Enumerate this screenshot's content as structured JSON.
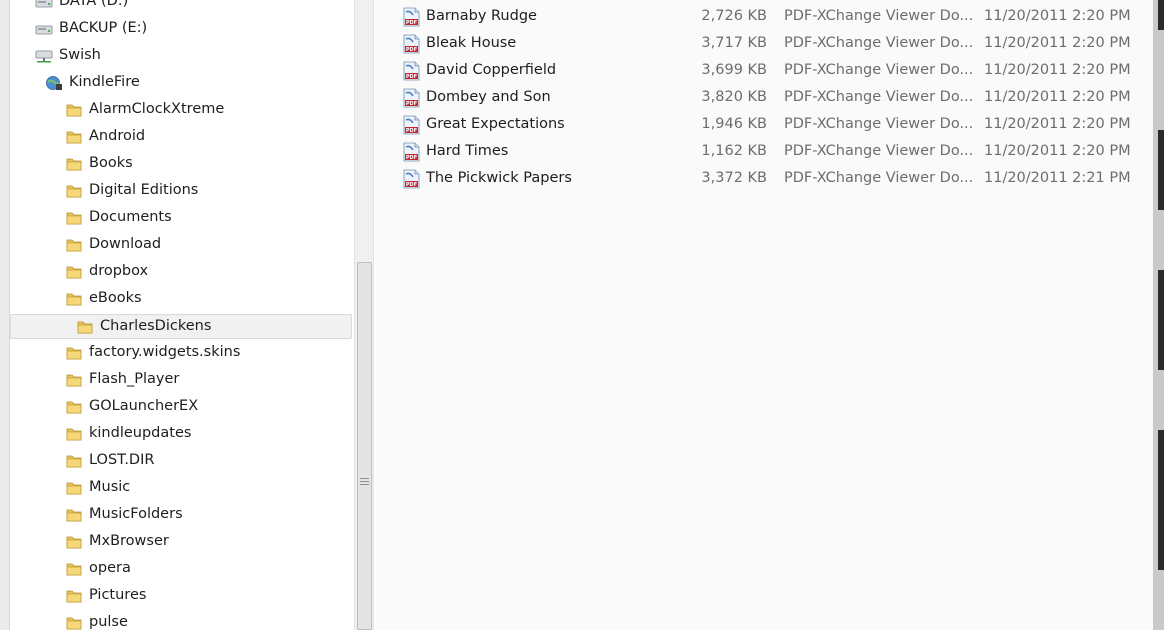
{
  "nav_tree": [
    {
      "label": "DATA (D:)",
      "icon": "drive-icon",
      "indent": 0
    },
    {
      "label": "BACKUP (E:)",
      "icon": "drive-icon",
      "indent": 0
    },
    {
      "label": "Swish",
      "icon": "network-drive-icon",
      "indent": 0
    },
    {
      "label": "KindleFire",
      "icon": "globe-device-icon",
      "indent": 1
    },
    {
      "label": "AlarmClockXtreme",
      "icon": "folder-icon",
      "indent": 2
    },
    {
      "label": "Android",
      "icon": "folder-icon",
      "indent": 2
    },
    {
      "label": "Books",
      "icon": "folder-icon",
      "indent": 2
    },
    {
      "label": "Digital Editions",
      "icon": "folder-icon",
      "indent": 2
    },
    {
      "label": "Documents",
      "icon": "folder-icon",
      "indent": 2
    },
    {
      "label": "Download",
      "icon": "folder-icon",
      "indent": 2
    },
    {
      "label": "dropbox",
      "icon": "folder-icon",
      "indent": 2
    },
    {
      "label": "eBooks",
      "icon": "folder-icon",
      "indent": 2
    },
    {
      "label": "CharlesDickens",
      "icon": "folder-icon",
      "indent": 3,
      "selected": true
    },
    {
      "label": "factory.widgets.skins",
      "icon": "folder-icon",
      "indent": 2
    },
    {
      "label": "Flash_Player",
      "icon": "folder-icon",
      "indent": 2
    },
    {
      "label": "GOLauncherEX",
      "icon": "folder-icon",
      "indent": 2
    },
    {
      "label": "kindleupdates",
      "icon": "folder-icon",
      "indent": 2
    },
    {
      "label": "LOST.DIR",
      "icon": "folder-icon",
      "indent": 2
    },
    {
      "label": "Music",
      "icon": "folder-icon",
      "indent": 2
    },
    {
      "label": "MusicFolders",
      "icon": "folder-icon",
      "indent": 2
    },
    {
      "label": "MxBrowser",
      "icon": "folder-icon",
      "indent": 2
    },
    {
      "label": "opera",
      "icon": "folder-icon",
      "indent": 2
    },
    {
      "label": "Pictures",
      "icon": "folder-icon",
      "indent": 2
    },
    {
      "label": "pulse",
      "icon": "folder-icon",
      "indent": 2
    }
  ],
  "files": [
    {
      "name": "Barnaby Rudge",
      "size": "2,726 KB",
      "type": "PDF-XChange Viewer Do...",
      "date": "11/20/2011 2:20 PM"
    },
    {
      "name": "Bleak House",
      "size": "3,717 KB",
      "type": "PDF-XChange Viewer Do...",
      "date": "11/20/2011 2:20 PM"
    },
    {
      "name": "David Copperfield",
      "size": "3,699 KB",
      "type": "PDF-XChange Viewer Do...",
      "date": "11/20/2011 2:20 PM"
    },
    {
      "name": "Dombey and Son",
      "size": "3,820 KB",
      "type": "PDF-XChange Viewer Do...",
      "date": "11/20/2011 2:20 PM"
    },
    {
      "name": "Great Expectations",
      "size": "1,946 KB",
      "type": "PDF-XChange Viewer Do...",
      "date": "11/20/2011 2:20 PM"
    },
    {
      "name": "Hard Times",
      "size": "1,162 KB",
      "type": "PDF-XChange Viewer Do...",
      "date": "11/20/2011 2:20 PM"
    },
    {
      "name": "The Pickwick Papers",
      "size": "3,372 KB",
      "type": "PDF-XChange Viewer Do...",
      "date": "11/20/2011 2:21 PM"
    }
  ],
  "colors": {
    "folder": "#e8c35a",
    "selection": "#f1f1f1",
    "pdf_red": "#c8242b",
    "detail_text": "#6d6d6d"
  }
}
